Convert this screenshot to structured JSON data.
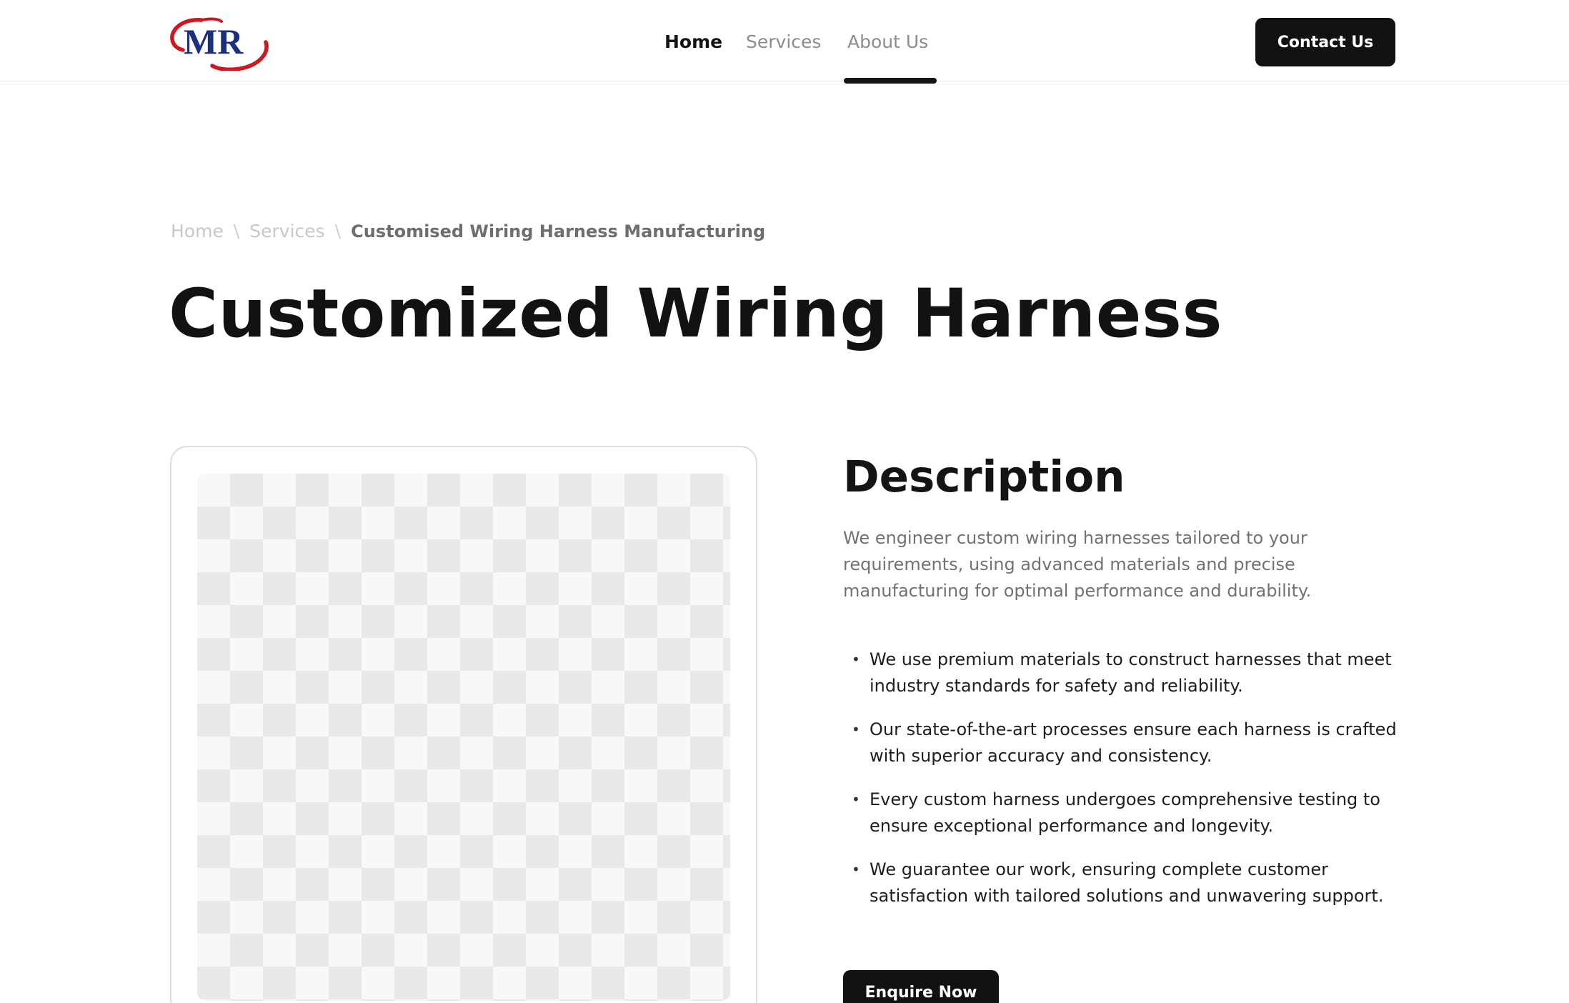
{
  "logo": {
    "text": "MR",
    "icon": "mr-logo-icon",
    "ring_color": "#d0161e",
    "text_color": "#1c2f7a"
  },
  "nav": {
    "items": [
      {
        "label": "Home"
      },
      {
        "label": "Services"
      },
      {
        "label": "About Us"
      }
    ],
    "contact_label": "Contact Us"
  },
  "breadcrumb": {
    "items": [
      "Home",
      "Services"
    ],
    "separator": "\\",
    "current": "Customised Wiring Harness Manufacturing"
  },
  "title": "Customized Wiring Harness",
  "image": {
    "placeholder": "transparent-checkerboard"
  },
  "description": {
    "heading": "Description",
    "intro": "We engineer custom wiring harnesses tailored to your requirements, using advanced materials and precise manufacturing for optimal performance and durability.",
    "bullet_glyph": "•",
    "points": [
      "We use premium materials to construct harnesses that meet industry standards for safety and reliability.",
      "Our state-of-the-art processes ensure each harness is crafted with superior accuracy and consistency.",
      "Every custom harness undergoes comprehensive testing to ensure exceptional performance and longevity.",
      "We guarantee our work, ensuring complete customer satisfaction with tailored solutions and unwavering support."
    ],
    "cta_label": "Enquire Now"
  },
  "colors": {
    "primary_button": "#111111",
    "muted_text": "#8c8c8c"
  }
}
